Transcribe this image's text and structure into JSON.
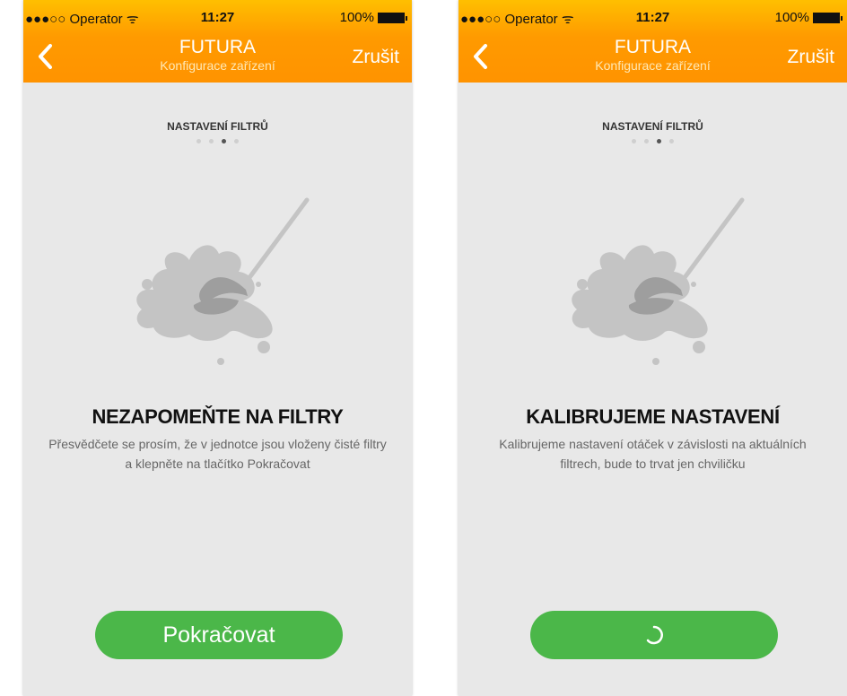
{
  "status": {
    "carrier": "●●●○○ Operator ᯤ",
    "time": "11:27",
    "battery": "100%"
  },
  "nav": {
    "title": "FUTURA",
    "subtitle": "Konfigurace zařízení",
    "cancel": "Zrušit",
    "back_icon": "chevron-left-icon"
  },
  "step": {
    "label": "NASTAVENÍ FILTRŮ",
    "total": 4,
    "current": 3
  },
  "screens": [
    {
      "heading": "NEZAPOMEŇTE NA FILTRY",
      "description": "Přesvědčete se prosím, že v jednotce jsou vloženy čisté filtry a klepněte na tlačítko Pokračovat",
      "button_label": "Pokračovat",
      "loading": false
    },
    {
      "heading": "KALIBRUJEME NASTAVENÍ",
      "description": "Kalibrujeme nastavení otáček v závislosti na aktuálních filtrech, bude to trvat jen chviličku",
      "button_label": "",
      "loading": true
    }
  ],
  "colors": {
    "header": "#ff9a00",
    "button": "#4bb749",
    "background": "#e8e8e8",
    "illustration": "#c4c4c4"
  }
}
